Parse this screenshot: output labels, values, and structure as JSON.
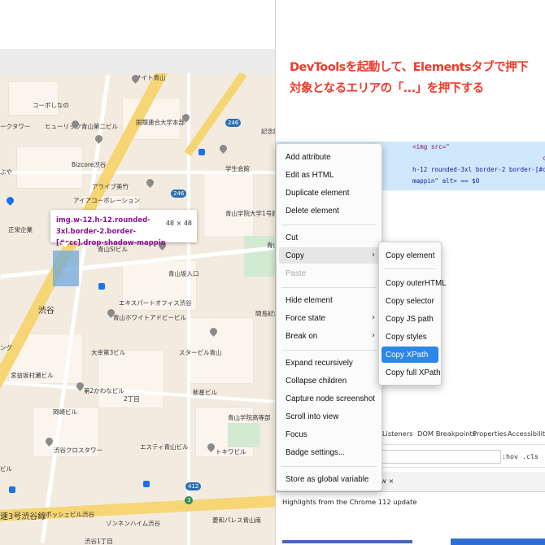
{
  "map": {
    "labels": {
      "a": "サイト青山",
      "b": "コーポしなの",
      "c": "国際連合大学本部",
      "d": "ークタワー",
      "e": "ヒューリック青山第二ビル",
      "f": "記念館",
      "g": "ぶや",
      "h": "Bizcore渋谷",
      "i": "学生会館",
      "j": "アライブ美竹",
      "k": "アイアコーポレーション",
      "l": "青山学院大学1号館",
      "m": "正栄企業",
      "n": "青山SIビル",
      "o": "青山坂入口",
      "p": "青山",
      "q": "渋谷",
      "r": "エキスパートオフィス渋谷",
      "s": "青山ホワイトアドビービル",
      "t": "間島記念",
      "u": "ング",
      "v": "大幸第3ビル",
      "w": "スターピル青山",
      "x": "宮益坂村瀬ビル",
      "y": "第2かわなビル",
      "z": "新星ビル",
      "aa": "岡崎ビル",
      "ab": "2丁目",
      "ac": "青山学院高等部",
      "ad": "渋谷クロスタワー",
      "ae": "エスティ青山ビル",
      "af": "トキワビル",
      "ag": "ビル",
      "ah": "速3号渋谷線",
      "ai": "ポッシェビル渋谷",
      "aj": "ゾンネンハイム渋谷",
      "ak": "菱和パレス青山南",
      "al": "渋谷1丁目",
      "am": "渋谷1丁目",
      "an": "青山",
      "ao": "渋谷"
    },
    "shields": {
      "s1": "246",
      "s2": "246",
      "s3": "412",
      "s4": "3"
    },
    "tooltip": {
      "selector": "img.w-12.h-12.rounded-3xl.border-2.border-[#ccc].drop-shadow-mappin",
      "size": "48 × 48"
    }
  },
  "devtools": {
    "title_line1": "DevToolsを起動して、Elementsタブで押下",
    "title_line2": "対象となるエリアの「...」を押下する",
    "code_line1": "<img src=\"",
    "code_line2": "c",
    "code_line3": "h-12 rounded-3xl border-2 border-[#ccc] d",
    "code_line4": "mappin\" alt> == $0",
    "tabs": [
      "t Listeners",
      "DOM Breakpoints",
      "Properties",
      "Accessibility"
    ],
    "filter_hov": ":hov .cls",
    "drawer_tab": "ew ×",
    "banner": "Highlights from the Chrome 112 update"
  },
  "context_menu": {
    "items": [
      "Add attribute",
      "Edit as HTML",
      "Duplicate element",
      "Delete element",
      "Cut",
      "Copy",
      "Paste",
      "Hide element",
      "Force state",
      "Break on",
      "Expand recursively",
      "Collapse children",
      "Capture node screenshot",
      "Scroll into view",
      "Focus",
      "Badge settings...",
      "Store as global variable"
    ],
    "arrow": "›"
  },
  "copy_submenu": {
    "items": [
      "Copy element",
      "Copy outerHTML",
      "Copy selector",
      "Copy JS path",
      "Copy styles",
      "Copy XPath",
      "Copy full XPath"
    ],
    "selected": "Copy XPath"
  },
  "colors": {
    "title": "#ef3a2a",
    "highlight": "#2b87e8",
    "code_row": "#cfe8fc"
  }
}
